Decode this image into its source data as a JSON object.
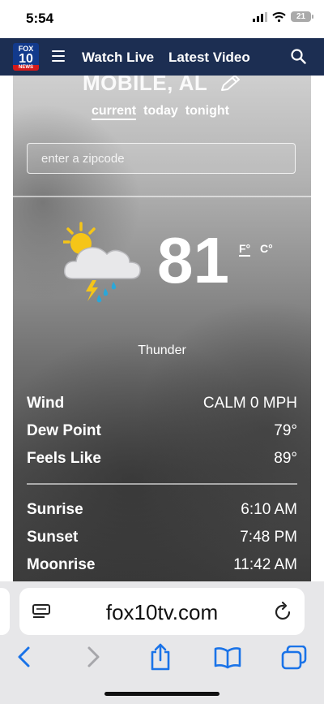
{
  "status_bar": {
    "time": "5:54",
    "battery": "21"
  },
  "nav": {
    "logo": {
      "line1": "FOX",
      "line2": "10",
      "line3": "NEWS"
    },
    "links": [
      "Watch Live",
      "Latest Video"
    ]
  },
  "weather": {
    "location": "MOBILE, AL",
    "tabs": [
      "current",
      "today",
      "tonight"
    ],
    "active_tab": "current",
    "zip_placeholder": "enter a zipcode",
    "icon": "thunderstorm-icon",
    "temperature": "81",
    "units": [
      "F°",
      "C°"
    ],
    "active_unit": "F°",
    "condition": "Thunder",
    "details": [
      {
        "label": "Wind",
        "value": "CALM 0 MPH"
      },
      {
        "label": "Dew Point",
        "value": "79°"
      },
      {
        "label": "Feels Like",
        "value": "89°"
      }
    ],
    "astro": [
      {
        "label": "Sunrise",
        "value": "6:10 AM"
      },
      {
        "label": "Sunset",
        "value": "7:48 PM"
      },
      {
        "label": "Moonrise",
        "value": "11:42 AM"
      }
    ]
  },
  "browser": {
    "url": "fox10tv.com",
    "accent_color": "#1a73e8"
  }
}
